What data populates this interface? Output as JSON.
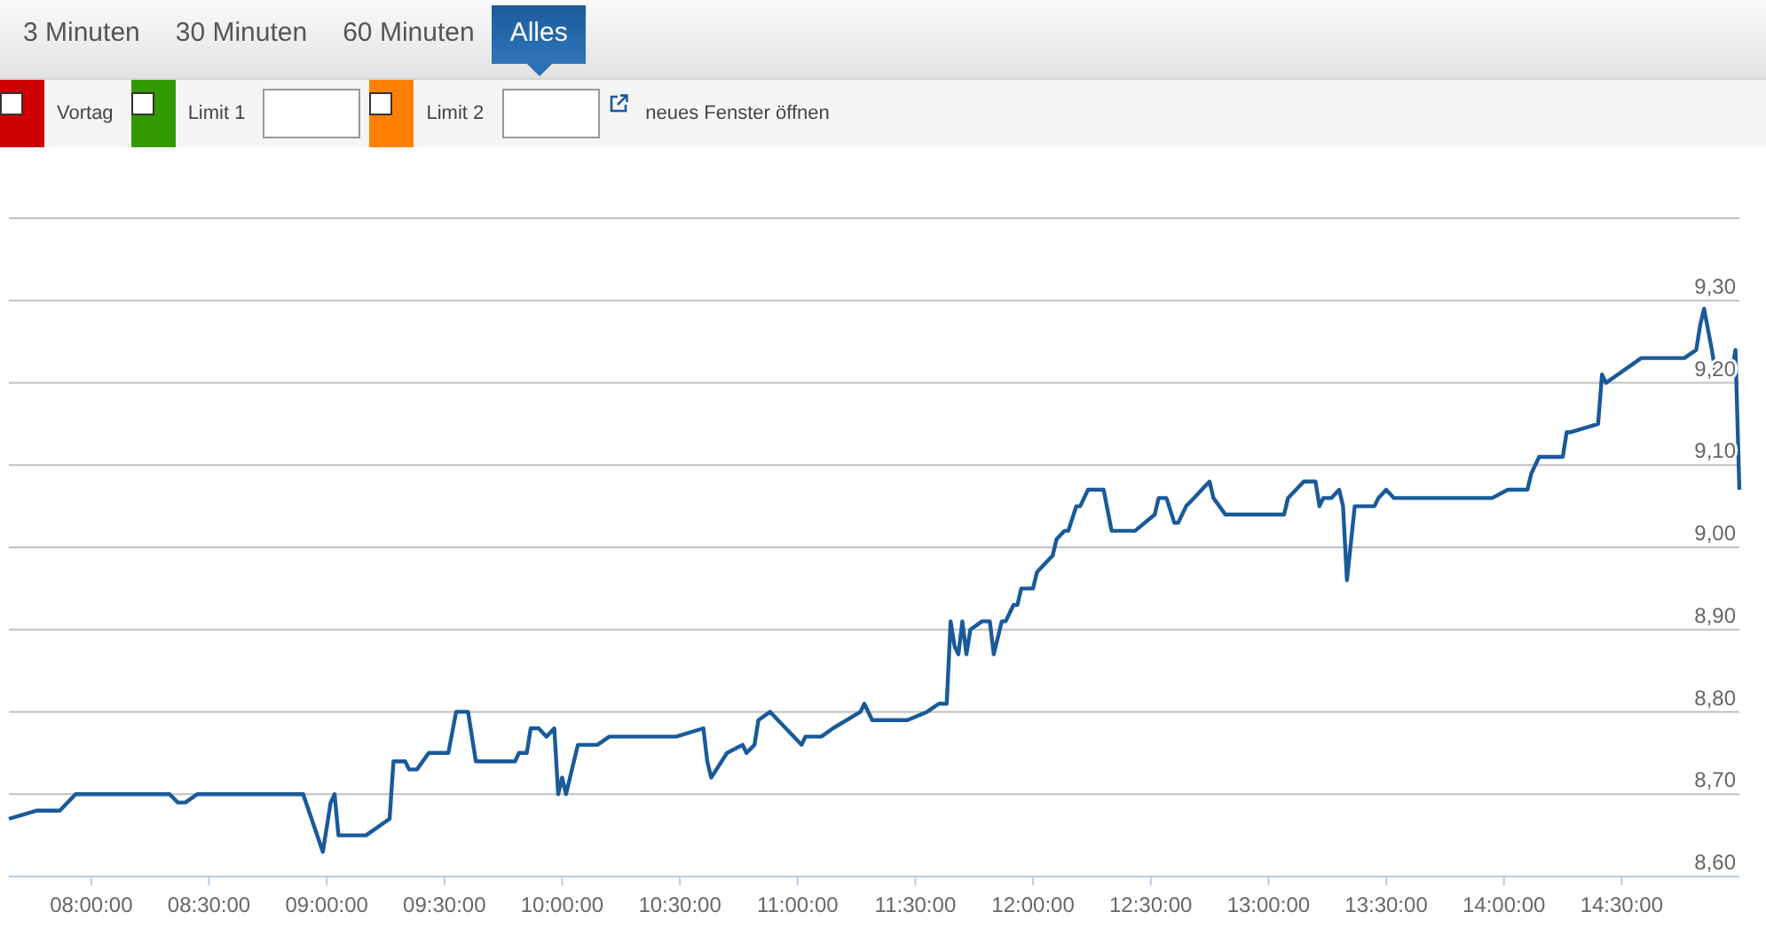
{
  "tabs": [
    {
      "label": "3 Minuten",
      "selected": false
    },
    {
      "label": "30 Minuten",
      "selected": false
    },
    {
      "label": "60 Minuten",
      "selected": false
    },
    {
      "label": "Alles",
      "selected": true
    }
  ],
  "options": [
    {
      "kind": "plain",
      "label": "Vortag",
      "color": "#cc0000",
      "checked": false
    },
    {
      "kind": "with_input",
      "label": "Limit 1",
      "color": "#339900",
      "checked": false
    },
    {
      "kind": "with_input",
      "label": "Limit 2",
      "color": "#ff8000",
      "checked": false
    }
  ],
  "popout_link": {
    "label": "neues Fenster öffnen"
  },
  "chart": {
    "chart_data": {
      "type": "line",
      "xlim": [
        459,
        900
      ],
      "ylim": [
        8.6,
        9.4
      ],
      "xticks": [
        {
          "value": 480,
          "label": "08:00:00"
        },
        {
          "value": 510,
          "label": "08:30:00"
        },
        {
          "value": 540,
          "label": "09:00:00"
        },
        {
          "value": 570,
          "label": "09:30:00"
        },
        {
          "value": 600,
          "label": "10:00:00"
        },
        {
          "value": 630,
          "label": "10:30:00"
        },
        {
          "value": 660,
          "label": "11:00:00"
        },
        {
          "value": 690,
          "label": "11:30:00"
        },
        {
          "value": 720,
          "label": "12:00:00"
        },
        {
          "value": 750,
          "label": "12:30:00"
        },
        {
          "value": 780,
          "label": "13:00:00"
        },
        {
          "value": 810,
          "label": "13:30:00"
        },
        {
          "value": 840,
          "label": "14:00:00"
        },
        {
          "value": 870,
          "label": "14:30:00"
        }
      ],
      "yticks": [
        {
          "value": 8.6,
          "label": "8,60"
        },
        {
          "value": 8.7,
          "label": "8,70"
        },
        {
          "value": 8.8,
          "label": "8,80"
        },
        {
          "value": 8.9,
          "label": "8,90"
        },
        {
          "value": 9.0,
          "label": "9,00"
        },
        {
          "value": 9.1,
          "label": "9,10"
        },
        {
          "value": 9.2,
          "label": "9,20"
        },
        {
          "value": 9.3,
          "label": "9,30"
        }
      ],
      "grid": true,
      "x": [
        459,
        466,
        472,
        476,
        500,
        502,
        504,
        507,
        534,
        539,
        541,
        542,
        543,
        550,
        556,
        557,
        560,
        561,
        563,
        566,
        571,
        573,
        576,
        578,
        581,
        588,
        589,
        591,
        592,
        594,
        596,
        598,
        599,
        600,
        601,
        604,
        609,
        612,
        629,
        636,
        637,
        638,
        642,
        646,
        647,
        649,
        650,
        653,
        661,
        662,
        666,
        669,
        676,
        677,
        679,
        688,
        693,
        696,
        698,
        699,
        700,
        701,
        702,
        703,
        704,
        707,
        709,
        710,
        712,
        713,
        715,
        716,
        717,
        720,
        721,
        723,
        725,
        726,
        728,
        729,
        731,
        732,
        734,
        737,
        738,
        740,
        746,
        751,
        752,
        754,
        756,
        757,
        759,
        761,
        763,
        765,
        766,
        769,
        784,
        785,
        789,
        792,
        793,
        794,
        796,
        798,
        799,
        800,
        802,
        807,
        808,
        810,
        812,
        835,
        837,
        841,
        846,
        847,
        849,
        855,
        856,
        857,
        864,
        865,
        866,
        869,
        875,
        886,
        889,
        890,
        891,
        893,
        894,
        897,
        898,
        899,
        900
      ],
      "series": [
        {
          "color": "#1a5a99",
          "values": [
            8.67,
            8.68,
            8.68,
            8.7,
            8.7,
            8.69,
            8.69,
            8.7,
            8.7,
            8.63,
            8.69,
            8.7,
            8.65,
            8.65,
            8.67,
            8.74,
            8.74,
            8.73,
            8.73,
            8.75,
            8.75,
            8.8,
            8.8,
            8.74,
            8.74,
            8.74,
            8.75,
            8.75,
            8.78,
            8.78,
            8.77,
            8.78,
            8.7,
            8.72,
            8.7,
            8.76,
            8.76,
            8.77,
            8.77,
            8.78,
            8.74,
            8.72,
            8.75,
            8.76,
            8.75,
            8.76,
            8.79,
            8.8,
            8.76,
            8.77,
            8.77,
            8.78,
            8.8,
            8.81,
            8.79,
            8.79,
            8.8,
            8.81,
            8.81,
            8.91,
            8.88,
            8.87,
            8.91,
            8.87,
            8.9,
            8.91,
            8.91,
            8.87,
            8.91,
            8.91,
            8.93,
            8.93,
            8.95,
            8.95,
            8.97,
            8.98,
            8.99,
            9.01,
            9.02,
            9.02,
            9.05,
            9.05,
            9.07,
            9.07,
            9.07,
            9.02,
            9.02,
            9.04,
            9.06,
            9.06,
            9.03,
            9.03,
            9.05,
            9.06,
            9.07,
            9.08,
            9.06,
            9.04,
            9.04,
            9.06,
            9.08,
            9.08,
            9.05,
            9.06,
            9.06,
            9.07,
            9.05,
            8.96,
            9.05,
            9.05,
            9.06,
            9.07,
            9.06,
            9.06,
            9.06,
            9.07,
            9.07,
            9.09,
            9.11,
            9.11,
            9.14,
            9.14,
            9.15,
            9.21,
            9.2,
            9.21,
            9.23,
            9.23,
            9.24,
            9.27,
            9.29,
            9.24,
            9.21,
            9.21,
            9.21,
            9.24,
            9.07
          ]
        }
      ]
    }
  }
}
